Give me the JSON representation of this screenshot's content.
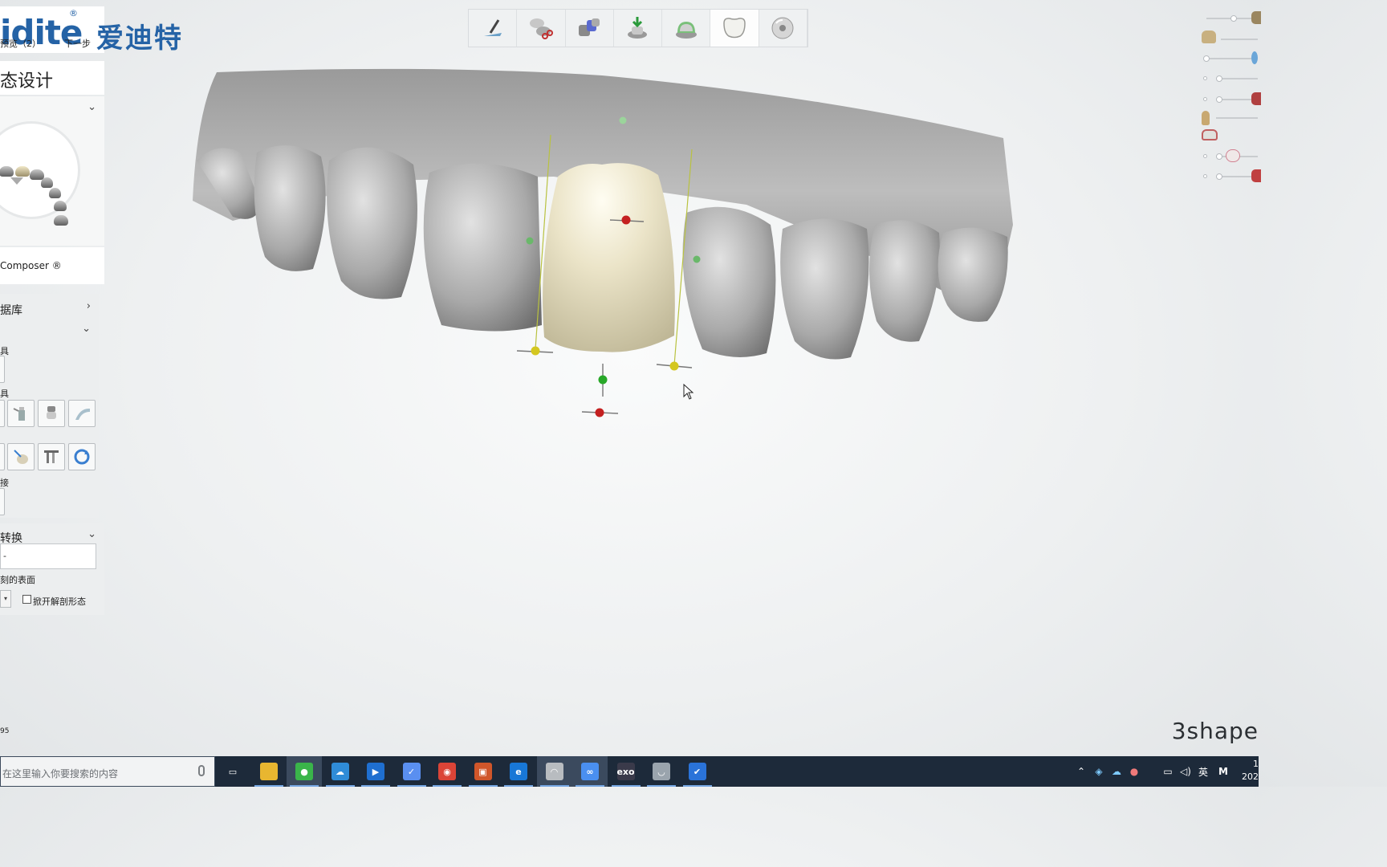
{
  "brand": {
    "latin": "idite",
    "reg_mark": "®",
    "chinese": "爱迪特",
    "sub_label": "预览（2）",
    "next_label": "下一步"
  },
  "left_panel": {
    "title": "态设计",
    "composer_label": "Composer ®",
    "library_label": "据库",
    "tools_label_1": "具",
    "tools_label_2": "具",
    "tools_label_3": "接",
    "morph_label": "转换",
    "morph_input_value": "-",
    "surface_label": "刻的表面",
    "checkbox_label": "掀开解剖形态",
    "version": "95"
  },
  "workflow_steps": [
    {
      "name": "scan-prep",
      "icon": "brush-icon"
    },
    {
      "name": "margin-cut",
      "icon": "scissors-icon"
    },
    {
      "name": "die-prep",
      "icon": "die-icon"
    },
    {
      "name": "insertion",
      "icon": "insertion-arrow-icon"
    },
    {
      "name": "cement-gap",
      "icon": "cement-icon"
    },
    {
      "name": "anatomy-design",
      "icon": "crown-icon",
      "active": true
    },
    {
      "name": "export",
      "icon": "disc-icon"
    }
  ],
  "right_controls": [
    {
      "name": "visibility-slider-1",
      "icon_color": "#9a8660",
      "level": 0.6
    },
    {
      "name": "visibility-slider-2",
      "icon_color": "#6ba6d8",
      "level": 0.45
    },
    {
      "name": "visibility-slider-3",
      "icon_color": "#555555",
      "level": 0.25
    },
    {
      "name": "visibility-slider-4",
      "icon_color": "#b04040",
      "level": 0.25
    },
    {
      "name": "visibility-slider-5",
      "icon_color": "#9a8660",
      "level": 0.25
    },
    {
      "name": "visibility-slider-6",
      "icon_color": "#d08090",
      "level": 0.45
    },
    {
      "name": "visibility-slider-7",
      "icon_color": "#c04040",
      "level": 0.25
    }
  ],
  "footer": {
    "vendor_logo": "3shape"
  },
  "taskbar": {
    "search_placeholder": "在这里输入你要搜索的内容",
    "apps": [
      {
        "name": "task-view",
        "color": "#1d2a3a",
        "glyph": "▭"
      },
      {
        "name": "file-explorer",
        "color": "#e8b630",
        "glyph": ""
      },
      {
        "name": "wechat",
        "color": "#3ab54a",
        "glyph": "●"
      },
      {
        "name": "onedrive",
        "color": "#2f8cd8",
        "glyph": "☁"
      },
      {
        "name": "video-app",
        "color": "#1f6fd0",
        "glyph": "▶"
      },
      {
        "name": "feishu",
        "color": "#5a8ff0",
        "glyph": "✓"
      },
      {
        "name": "chrome",
        "color": "#db4437",
        "glyph": "◉"
      },
      {
        "name": "office",
        "color": "#d0562a",
        "glyph": "▣"
      },
      {
        "name": "edge",
        "color": "#1877d6",
        "glyph": "e"
      },
      {
        "name": "dental-system",
        "color": "#b8bcc0",
        "glyph": "◠"
      },
      {
        "name": "baidu-netdisk",
        "color": "#4a8ff0",
        "glyph": "∞"
      },
      {
        "name": "exocad",
        "color": "#3a3a4a",
        "glyph": "exo"
      },
      {
        "name": "trios",
        "color": "#9aa4ad",
        "glyph": "◡"
      },
      {
        "name": "security-app",
        "color": "#2a73d9",
        "glyph": "✔"
      }
    ],
    "ime_label": "英",
    "clock_line1": "1",
    "clock_line2": "202"
  }
}
